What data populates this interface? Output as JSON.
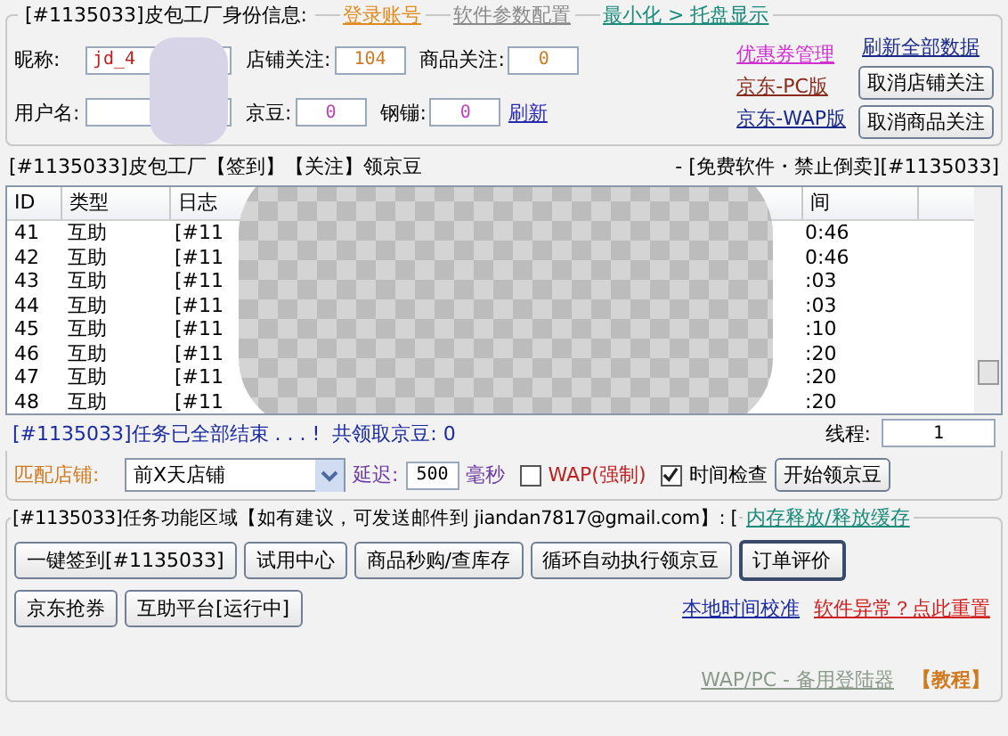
{
  "identity": {
    "title": "[#1135033]皮包工厂身份信息:",
    "top_links": [
      {
        "label": "登录账号",
        "color": "#e08a1e"
      },
      {
        "label": "软件参数配置",
        "color": "#8a8a8a"
      },
      {
        "label": "最小化 > 托盘显示",
        "color": "#1a8a7a"
      }
    ],
    "rows": [
      [
        {
          "label": "昵称:",
          "value": "jd_4"
        },
        {
          "label": "店铺关注:",
          "value": "104"
        },
        {
          "label": "商品关注:",
          "value": "0"
        }
      ],
      [
        {
          "label": "用户名:"
        },
        {
          "label": "京豆:",
          "value": "0"
        },
        {
          "label": "钢镚:",
          "value": "0"
        }
      ]
    ],
    "refresh_link": "刷新",
    "side_links": [
      {
        "label": "优惠券管理",
        "color": "#d030d0"
      },
      {
        "label": "京东-PC版",
        "color": "#8a2a1a"
      },
      {
        "label": "京东-WAP版",
        "color": "#1a2a8a"
      }
    ],
    "right_link": {
      "label": "刷新全部数据",
      "color": "#1a2a8a"
    },
    "buttons": [
      "取消店铺关注",
      "取消商品关注"
    ]
  },
  "tasks": {
    "title_left": "[#1135033]皮包工厂【签到】【关注】领京豆",
    "title_right": "- [免费软件・禁止倒卖][#1135033]",
    "columns": [
      "ID",
      "类型",
      "日志",
      "间"
    ],
    "rows": [
      {
        "id": "41",
        "type": "互助",
        "log": "[#11",
        "time": "0:46"
      },
      {
        "id": "42",
        "type": "互助",
        "log": "[#11",
        "time": "0:46"
      },
      {
        "id": "43",
        "type": "互助",
        "log": "[#11",
        "time": ":03"
      },
      {
        "id": "44",
        "type": "互助",
        "log": "[#11",
        "time": ":03"
      },
      {
        "id": "45",
        "type": "互助",
        "log": "[#11",
        "time": ":10"
      },
      {
        "id": "46",
        "type": "互助",
        "log": "[#11",
        "time": ":20"
      },
      {
        "id": "47",
        "type": "互助",
        "log": "[#11",
        "time": ":20"
      },
      {
        "id": "48",
        "type": "互助",
        "log": "[#11",
        "time": ":20"
      }
    ],
    "status": "[#1135033]任务已全部结束 . . . !  共领取京豆: 0",
    "threads": {
      "label": "线程:",
      "value": "1"
    },
    "shop_label": "匹配店铺:",
    "shop_select": "前X天店铺",
    "delay": {
      "label": "延迟:",
      "value": "500",
      "unit": "毫秒"
    },
    "checks": [
      {
        "label": "WAP(强制)",
        "checked": false,
        "color": "#c02020"
      },
      {
        "label": "时间检查",
        "checked": true,
        "color": "#000000"
      }
    ],
    "start_button": "开始领京豆"
  },
  "functions": {
    "title": "[#1135033]任务功能区域【如有建议，可发送邮件到 jiandan7817@gmail.com】: [",
    "cache_link": "内存释放/释放缓存",
    "button_rows": [
      [
        {
          "label": "一键签到[#1135033]",
          "focused": false
        },
        {
          "label": "试用中心",
          "focused": false
        },
        {
          "label": "商品秒购/查库存",
          "focused": false
        },
        {
          "label": "循环自动执行领京豆",
          "focused": false
        },
        {
          "label": "订单评价",
          "focused": true
        }
      ],
      [
        {
          "label": "京东抢券",
          "focused": false
        },
        {
          "label": "互助平台[运行中]",
          "focused": false
        }
      ]
    ],
    "links": [
      {
        "label": "本地时间校准",
        "color": "#1a2aa0"
      },
      {
        "label": "软件异常？点此重置",
        "color": "#d02020"
      }
    ],
    "footer_link": "WAP/PC - 备用登陆器",
    "tutorial": "【教程】"
  }
}
